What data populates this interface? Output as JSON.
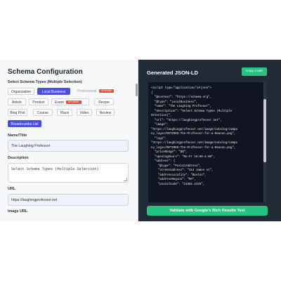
{
  "left": {
    "title": "Schema Configuration",
    "select_label": "Select Schema Types (Multiple Selection)",
    "chips_row1": [
      "Organization",
      "Local Business",
      "Professional"
    ],
    "premium_badge": "UPGRADE",
    "chips_row2": [
      "Article",
      "Product",
      "Event",
      "Recipe"
    ],
    "chips_row3": [
      "Blog Post",
      "Course",
      "Place",
      "Video",
      "Review"
    ],
    "breadcrumbs": "Breadcrumbs List",
    "name_label": "Name/Title",
    "name_value": "The Laughing Professor",
    "description_label": "Description",
    "description_value": "Select Schema Types (Multiple Selection)",
    "url_label": "URL",
    "url_value": "https://laughingprofessor.net",
    "image_label": "Image URL"
  },
  "right": {
    "title": "Generated JSON-LD",
    "copy_label": "Copy Code",
    "code": "<script type=\"application/ld+json\">\n{\n  \"@context\": \"https://schema.org\",\n  \"@type\": \"LocalBusiness\",\n  \"name\": \"The Laughing Professor\",\n  \"description\": \"Select Schema Types (Multiple\nSelection)\",\n  \"url\": \"https://laughingprofessor.net\",\n  \"image\":\n\"https://laughingprofessor.net/image/catalog/compa\nny_logos/RETIRED-The-Professor-for-a-Reason.png\",\n  \"logo\":\n\"https://laughingprofessor.net/image/catalog/compa\nny_logos/RETIRED-The-Professor-for-a-Reason.png\",\n  \"priceRange\": \"$$\",\n  \"openingHours\": \"Mo-Fr 10:00-4:00\",\n  \"address\": {\n    \"@type\": \"PostalAddress\",\n    \"streetAddress\": \"314 James st\",\n    \"addressLocality\": \"Boston\",\n    \"addressRegion\": \"MA\",\n    \"postalCode\": \"21501-2329\",",
    "validate_label": "Validate with Google's Rich Results Test"
  }
}
